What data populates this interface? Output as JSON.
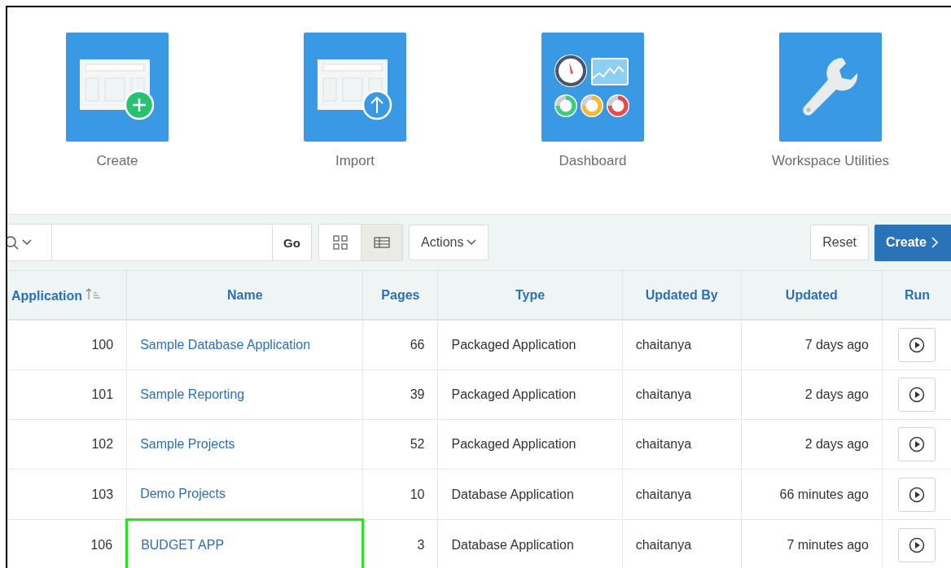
{
  "tiles": [
    {
      "kind": "create",
      "label": "Create"
    },
    {
      "kind": "import",
      "label": "Import"
    },
    {
      "kind": "dashboard",
      "label": "Dashboard"
    },
    {
      "kind": "utilities",
      "label": "Workspace Utilities"
    }
  ],
  "toolbar": {
    "go": "Go",
    "views": [
      {
        "kind": "icons",
        "selected": false
      },
      {
        "kind": "report",
        "selected": true
      }
    ],
    "actions": "Actions",
    "reset": "Reset",
    "create": "Create"
  },
  "table": {
    "columns": [
      {
        "label": "Application",
        "sorted": true
      },
      {
        "label": "Name",
        "sorted": false
      },
      {
        "label": "Pages",
        "sorted": false
      },
      {
        "label": "Type",
        "sorted": false
      },
      {
        "label": "Updated By",
        "sorted": false
      },
      {
        "label": "Updated",
        "sorted": false
      },
      {
        "label": "Run",
        "sorted": false
      }
    ],
    "rows": [
      {
        "id": "100",
        "name": "Sample Database Application",
        "pages": "66",
        "type": "Packaged Application",
        "updated_by": "chaitanya",
        "updated": "7 days ago",
        "highlighted": false
      },
      {
        "id": "101",
        "name": "Sample Reporting",
        "pages": "39",
        "type": "Packaged Application",
        "updated_by": "chaitanya",
        "updated": "2 days ago",
        "highlighted": false
      },
      {
        "id": "102",
        "name": "Sample Projects",
        "pages": "52",
        "type": "Packaged Application",
        "updated_by": "chaitanya",
        "updated": "2 days ago",
        "highlighted": false
      },
      {
        "id": "103",
        "name": "Demo Projects",
        "pages": "10",
        "type": "Database Application",
        "updated_by": "chaitanya",
        "updated": "66 minutes ago",
        "highlighted": false
      },
      {
        "id": "106",
        "name": "BUDGET APP",
        "pages": "3",
        "type": "Database Application",
        "updated_by": "chaitanya",
        "updated": "7 minutes ago",
        "highlighted": true
      }
    ]
  }
}
